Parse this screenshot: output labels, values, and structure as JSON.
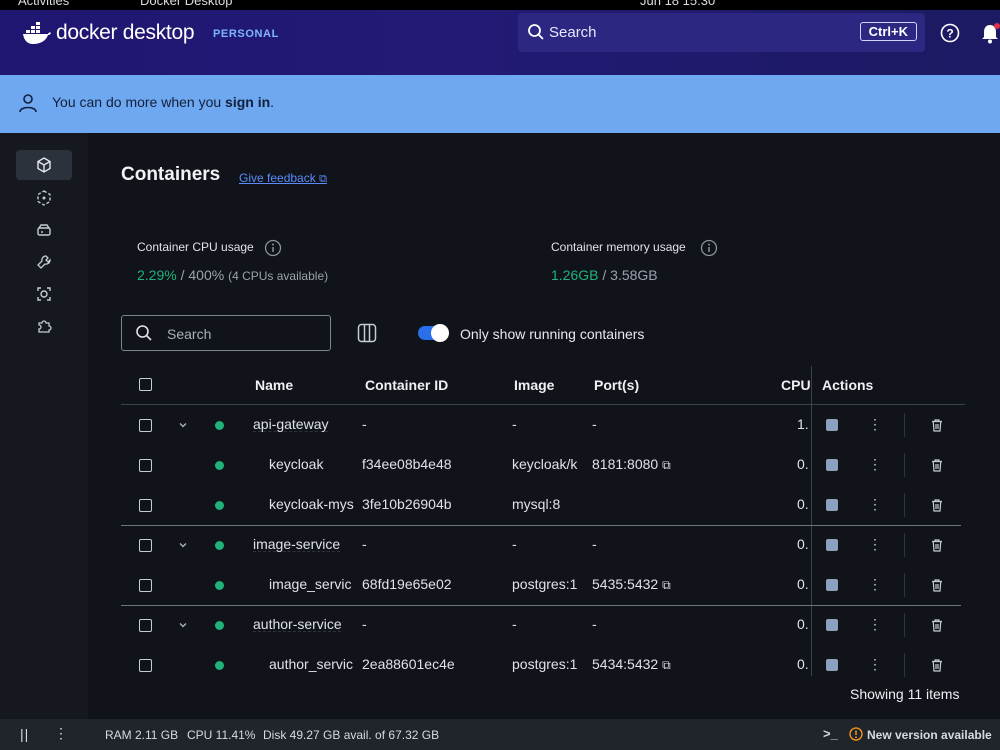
{
  "system": {
    "activities": "Activities",
    "app_name": "Docker Desktop",
    "clock": "Jun 18 15:30"
  },
  "header": {
    "brand": "docker desktop",
    "plan": "PERSONAL",
    "search_label": "Search",
    "search_shortcut": "Ctrl+K"
  },
  "banner": {
    "text": "You can do more when you ",
    "link": "sign in",
    "suffix": "."
  },
  "sidebar": {
    "items": [
      "containers-icon",
      "images-icon",
      "volumes-icon",
      "builds-icon",
      "scout-icon",
      "extensions-icon"
    ]
  },
  "page": {
    "title": "Containers",
    "feedback": "Give feedback",
    "cpu_label": "Container CPU usage",
    "cpu_value": "2.29%",
    "cpu_total": " / 400%",
    "cpu_note": "(4 CPUs available)",
    "mem_label": "Container memory usage",
    "mem_value": "1.26GB",
    "mem_total": " / 3.58GB",
    "search_placeholder": "Search",
    "toggle_label": "Only show running containers"
  },
  "table": {
    "headers": {
      "name": "Name",
      "id": "Container ID",
      "image": "Image",
      "ports": "Port(s)",
      "cpu": "CPU",
      "actions": "Actions"
    },
    "rows": [
      {
        "name": "api-gateway",
        "id": "-",
        "image": "-",
        "ports": "-",
        "cpu": "1.",
        "group": true
      },
      {
        "name": "keycloak",
        "id": "f34ee08b4e48",
        "image": "keycloak/k",
        "ports": "8181:8080",
        "cpu": "0.",
        "group": false
      },
      {
        "name": "keycloak-mys",
        "id": "3fe10b26904b",
        "image": "mysql:8",
        "ports": "",
        "cpu": "0.",
        "group": false
      },
      {
        "name": "image-service",
        "id": "-",
        "image": "-",
        "ports": "-",
        "cpu": "0.",
        "group": true
      },
      {
        "name": "image_servic",
        "id": "68fd19e65e02",
        "image": "postgres:1",
        "ports": "5435:5432",
        "cpu": "0.",
        "group": false
      },
      {
        "name": "author-service",
        "id": "-",
        "image": "-",
        "ports": "-",
        "cpu": "0.",
        "group": true
      },
      {
        "name": "author_servic",
        "id": "2ea88601ec4e",
        "image": "postgres:1",
        "ports": "5434:5432",
        "cpu": "0.",
        "group": false
      }
    ],
    "showing": "Showing 11 items"
  },
  "footer": {
    "ram": "RAM 2.11 GB",
    "cpu": "CPU 11.41%",
    "disk": "Disk 49.27 GB avail. of 67.32 GB",
    "update": "New version available"
  },
  "colors": {
    "accent": "#2a6fea",
    "running": "#1fb27c",
    "header": "#1f1672",
    "banner": "#6ea8f0"
  }
}
